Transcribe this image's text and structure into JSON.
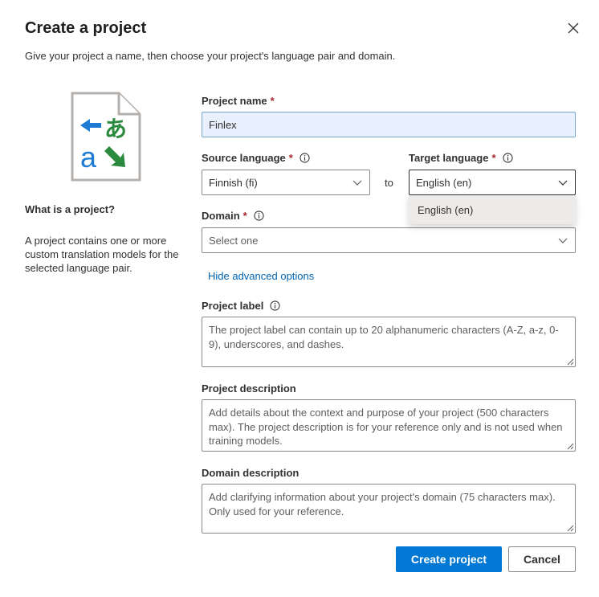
{
  "dialog": {
    "title": "Create a project",
    "subtitle": "Give your project a name, then choose your project's language pair and domain.",
    "close_icon": "close-icon"
  },
  "sidebar": {
    "illustration_icon": "translate-document-icon",
    "heading": "What is a project?",
    "body": "A project contains one or more custom translation models for the selected language pair."
  },
  "form": {
    "project_name": {
      "label": "Project name",
      "required_mark": "*",
      "value": "Finlex"
    },
    "source_language": {
      "label": "Source language",
      "required_mark": "*",
      "value": "Finnish (fi)"
    },
    "to_text": "to",
    "target_language": {
      "label": "Target language",
      "required_mark": "*",
      "value": "English (en)",
      "options": [
        "English (en)"
      ]
    },
    "domain": {
      "label": "Domain",
      "required_mark": "*",
      "placeholder": "Select one"
    },
    "advanced_link": "Hide advanced options",
    "project_label": {
      "label": "Project label",
      "placeholder": "The project label can contain up to 20 alphanumeric characters (A-Z, a-z, 0-9), underscores, and dashes."
    },
    "project_description": {
      "label": "Project description",
      "placeholder": "Add details about the context and purpose of your project (500 characters max). The project description is for your reference only and is not used when training models."
    },
    "domain_description": {
      "label": "Domain description",
      "placeholder": "Add clarifying information about your project's domain (75 characters max). Only used for your reference."
    }
  },
  "actions": {
    "create_label": "Create project",
    "cancel_label": "Cancel"
  },
  "colors": {
    "primary": "#0078d4",
    "link": "#0063b1",
    "required": "#a4262c",
    "icon_blue": "#1e7bd4",
    "icon_green": "#2b8a3e"
  }
}
